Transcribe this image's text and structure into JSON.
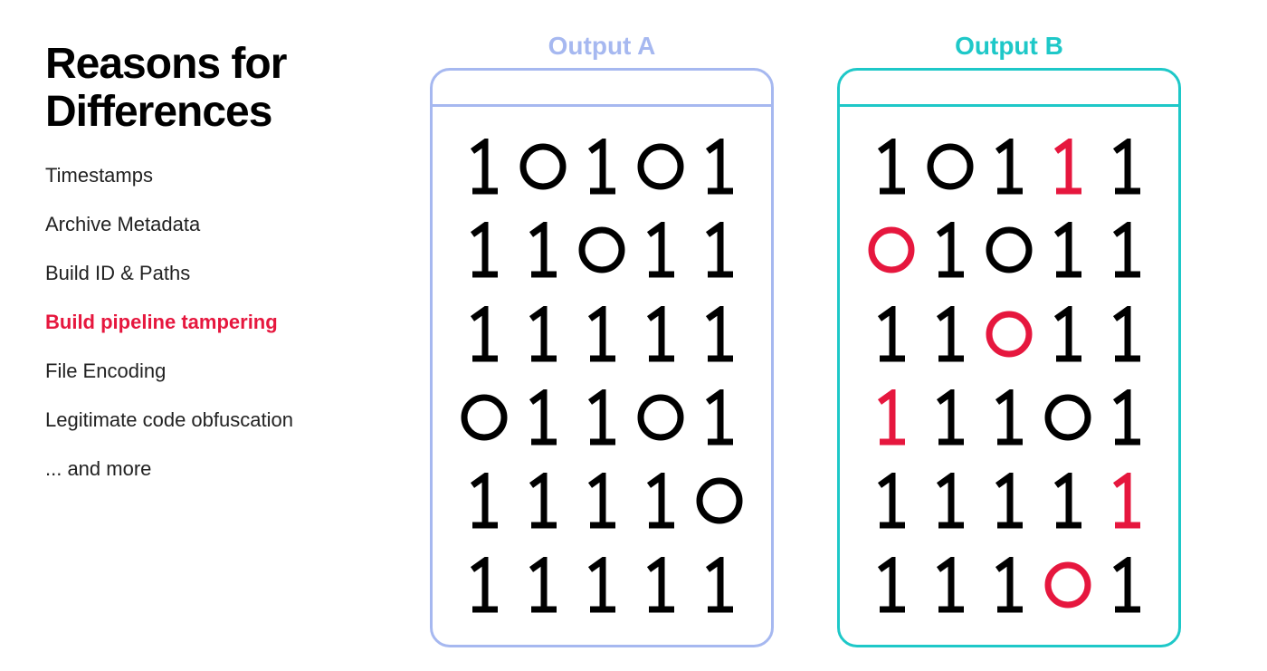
{
  "title_line1": "Reasons for",
  "title_line2": "Differences",
  "reasons": [
    {
      "text": "Timestamps",
      "highlight": false
    },
    {
      "text": "Archive Metadata",
      "highlight": false
    },
    {
      "text": "Build ID & Paths",
      "highlight": false
    },
    {
      "text": "Build pipeline tampering",
      "highlight": true
    },
    {
      "text": "File Encoding",
      "highlight": false
    },
    {
      "text": "Legitimate code obfuscation",
      "highlight": false
    },
    {
      "text": "... and more",
      "highlight": false
    }
  ],
  "colors": {
    "output_a": "#a6b8f0",
    "output_b": "#1ec8c8",
    "highlight": "#e6173e",
    "normal": "#000000"
  },
  "outputs": [
    {
      "label": "Output A",
      "label_color": "#a6b8f0",
      "border_class": "card-a",
      "rows": [
        [
          {
            "v": "1",
            "d": false
          },
          {
            "v": "0",
            "d": false
          },
          {
            "v": "1",
            "d": false
          },
          {
            "v": "0",
            "d": false
          },
          {
            "v": "1",
            "d": false
          }
        ],
        [
          {
            "v": "1",
            "d": false
          },
          {
            "v": "1",
            "d": false
          },
          {
            "v": "0",
            "d": false
          },
          {
            "v": "1",
            "d": false
          },
          {
            "v": "1",
            "d": false
          }
        ],
        [
          {
            "v": "1",
            "d": false
          },
          {
            "v": "1",
            "d": false
          },
          {
            "v": "1",
            "d": false
          },
          {
            "v": "1",
            "d": false
          },
          {
            "v": "1",
            "d": false
          }
        ],
        [
          {
            "v": "0",
            "d": false
          },
          {
            "v": "1",
            "d": false
          },
          {
            "v": "1",
            "d": false
          },
          {
            "v": "0",
            "d": false
          },
          {
            "v": "1",
            "d": false
          }
        ],
        [
          {
            "v": "1",
            "d": false
          },
          {
            "v": "1",
            "d": false
          },
          {
            "v": "1",
            "d": false
          },
          {
            "v": "1",
            "d": false
          },
          {
            "v": "0",
            "d": false
          }
        ],
        [
          {
            "v": "1",
            "d": false
          },
          {
            "v": "1",
            "d": false
          },
          {
            "v": "1",
            "d": false
          },
          {
            "v": "1",
            "d": false
          },
          {
            "v": "1",
            "d": false
          }
        ]
      ]
    },
    {
      "label": "Output B",
      "label_color": "#1ec8c8",
      "border_class": "card-b",
      "rows": [
        [
          {
            "v": "1",
            "d": false
          },
          {
            "v": "0",
            "d": false
          },
          {
            "v": "1",
            "d": false
          },
          {
            "v": "1",
            "d": true
          },
          {
            "v": "1",
            "d": false
          }
        ],
        [
          {
            "v": "0",
            "d": true
          },
          {
            "v": "1",
            "d": false
          },
          {
            "v": "0",
            "d": false
          },
          {
            "v": "1",
            "d": false
          },
          {
            "v": "1",
            "d": false
          }
        ],
        [
          {
            "v": "1",
            "d": false
          },
          {
            "v": "1",
            "d": false
          },
          {
            "v": "0",
            "d": true
          },
          {
            "v": "1",
            "d": false
          },
          {
            "v": "1",
            "d": false
          }
        ],
        [
          {
            "v": "1",
            "d": true
          },
          {
            "v": "1",
            "d": false
          },
          {
            "v": "1",
            "d": false
          },
          {
            "v": "0",
            "d": false
          },
          {
            "v": "1",
            "d": false
          }
        ],
        [
          {
            "v": "1",
            "d": false
          },
          {
            "v": "1",
            "d": false
          },
          {
            "v": "1",
            "d": false
          },
          {
            "v": "1",
            "d": false
          },
          {
            "v": "1",
            "d": true
          }
        ],
        [
          {
            "v": "1",
            "d": false
          },
          {
            "v": "1",
            "d": false
          },
          {
            "v": "1",
            "d": false
          },
          {
            "v": "0",
            "d": true
          },
          {
            "v": "1",
            "d": false
          }
        ]
      ]
    }
  ]
}
